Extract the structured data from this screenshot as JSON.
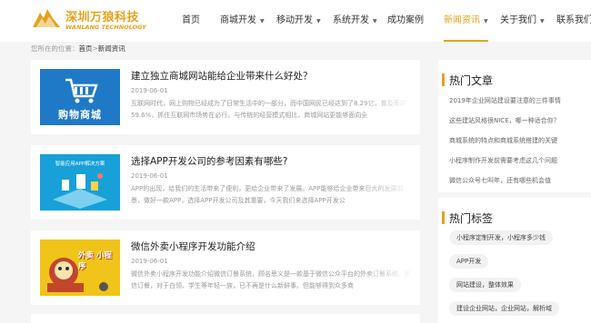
{
  "header": {
    "brand_cn": "深圳万狼科技",
    "brand_en": "WANLANG TECHNOLOGY",
    "nav": [
      {
        "label": "首页",
        "has_caret": false,
        "active": false
      },
      {
        "label": "商城开发",
        "has_caret": true,
        "active": false
      },
      {
        "label": "移动开发",
        "has_caret": true,
        "active": false
      },
      {
        "label": "系统开发",
        "has_caret": true,
        "active": false
      },
      {
        "label": "成功案例",
        "has_caret": false,
        "active": false
      },
      {
        "label": "新闻资讯",
        "has_caret": true,
        "active": true
      },
      {
        "label": "关于我们",
        "has_caret": true,
        "active": false
      },
      {
        "label": "联系我们",
        "has_caret": false,
        "active": false
      }
    ],
    "caret_glyph": "▼"
  },
  "breadcrumb": {
    "prefix": "您所在的位置：",
    "home": "首页",
    "separator": ">",
    "current": "新闻资讯"
  },
  "articles": [
    {
      "title": "建立独立商城网站能给企业带来什么好处？",
      "date": "2019-06-01",
      "excerpt": "互联网时代，网上购物已经成为了日常生活中的一部分，而中国网民已经达到了8.29亿，普及率达59.6%，抓住互联网市场势在必行。与传统的经营模式相比，商城网站更能够面向全",
      "thumb_text": "购物商城",
      "thumb_bg": "#2079c7"
    },
    {
      "title": "选择APP开发公司的参考因素有哪些?",
      "date": "2019-06-01",
      "excerpt": "APP的出现，给我们的生活带来了便利，更给企业带来了发展。APP能够给企业带来巨大的发展前景，做好一款APP，选择APP开发公司及其重要，今天我们来选择APP开发公",
      "thumb_text": "智能应用APP解决方案",
      "thumb_bg": "#18a0d8"
    },
    {
      "title": "微信外卖小程序开发功能介绍",
      "date": "2019-06-01",
      "excerpt": "微信外卖小程序开发功能介绍微信订餐系统，顾名思义是一款基于微信公众平台的外卖订餐系统。微信订餐，对于白领、学生等年轻一族，已不再是什么新鲜事。但能够得到众多商",
      "thumb_text": "外卖 小程序",
      "thumb_bg": "#f0c419"
    }
  ],
  "sidebar": {
    "hot_articles_title": "热门文章",
    "hot_articles": [
      "2019年企业网站建设要注意的三件事情",
      "这些建站风格很NICE，哪一种适合你？",
      "商城系统的特点和商城系统搭建的关键",
      "小程序制作开发前需要考虑这几个问题",
      "微信公众号七叫年，还有哪些机会值"
    ],
    "hot_tags_title": "热门标签",
    "hot_tags": [
      "小程序定制开发，小程序多少钱",
      "APP开发",
      "网站建设，整体效果",
      "建设企业网站，企业网站，解析域"
    ]
  },
  "colors": {
    "accent": "#e6a21a",
    "page_bg": "#f5f5f5"
  }
}
